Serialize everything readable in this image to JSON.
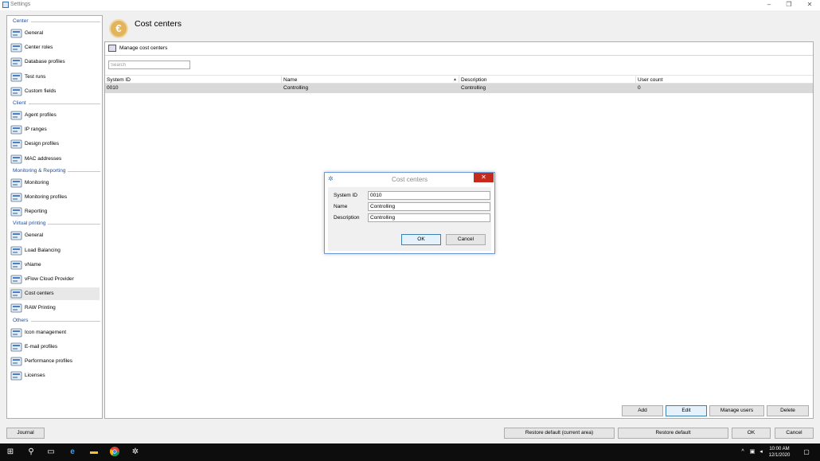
{
  "window": {
    "title": "Settings"
  },
  "sidebar": {
    "sections": [
      {
        "label": "Center",
        "items": [
          {
            "label": "General",
            "icon": "grid-icon"
          },
          {
            "label": "Center roles",
            "icon": "users-icon"
          },
          {
            "label": "Database profiles",
            "icon": "database-icon"
          },
          {
            "label": "Test runs",
            "icon": "test-runs-icon"
          },
          {
            "label": "Custom fields",
            "icon": "custom-fields-icon"
          }
        ]
      },
      {
        "label": "Client",
        "items": [
          {
            "label": "Agent profiles",
            "icon": "agent-profiles-icon"
          },
          {
            "label": "IP ranges",
            "icon": "network-plug-icon"
          },
          {
            "label": "Design profiles",
            "icon": "monitor-icon"
          },
          {
            "label": "MAC addresses",
            "icon": "network-card-icon"
          }
        ]
      },
      {
        "label": "Monitoring & Reporting",
        "items": [
          {
            "label": "Monitoring",
            "icon": "monitoring-icon"
          },
          {
            "label": "Monitoring profiles",
            "icon": "monitoring-profiles-icon"
          },
          {
            "label": "Reporting",
            "icon": "book-icon"
          }
        ]
      },
      {
        "label": "Virtual printing",
        "items": [
          {
            "label": "General",
            "icon": "printer-icon"
          },
          {
            "label": "Load Balancing",
            "icon": "load-balancing-icon"
          },
          {
            "label": "vName",
            "icon": "printer-icon"
          },
          {
            "label": "vFlow Cloud Provider",
            "icon": "cloud-network-icon"
          },
          {
            "label": "Cost centers",
            "icon": "euro-icon",
            "selected": true
          },
          {
            "label": "RAW Printing",
            "icon": "raw-printing-icon"
          }
        ]
      },
      {
        "label": "Others",
        "items": [
          {
            "label": "Icon management",
            "icon": "icon-management-icon"
          },
          {
            "label": "E-mail profiles",
            "icon": "email-profiles-icon"
          },
          {
            "label": "Performance profiles",
            "icon": "performance-icon"
          },
          {
            "label": "Licenses",
            "icon": "key-icon"
          }
        ]
      }
    ]
  },
  "header": {
    "title": "Cost centers",
    "icon": "euro-icon"
  },
  "panel": {
    "title": "Manage cost centers",
    "search_placeholder": "Search",
    "columns": [
      "System ID",
      "Name",
      "Description",
      "User count"
    ],
    "rows": [
      [
        "0010",
        "Controlling",
        "Controlling",
        "0"
      ]
    ],
    "buttons": {
      "add": "Add",
      "edit": "Edit",
      "manage_users": "Manage users",
      "delete": "Delete"
    }
  },
  "dialog": {
    "title": "Cost centers",
    "fields": [
      {
        "label": "System ID",
        "value": "0010"
      },
      {
        "label": "Name",
        "value": "Controlling"
      },
      {
        "label": "Description",
        "value": "Controlling"
      }
    ],
    "ok": "OK",
    "cancel": "Cancel"
  },
  "footer": {
    "journal": "Journal",
    "restore_current": "Restore default (current area)",
    "restore_default": "Restore default",
    "ok": "OK",
    "cancel": "Cancel"
  },
  "taskbar": {
    "time": "10:00 AM",
    "date": "12/1/2020"
  },
  "colors": {
    "accent": "#1f4e9c",
    "selection": "#d9d9d9",
    "close_red": "#c42b1c",
    "euro_gold": "#e2b45c"
  }
}
